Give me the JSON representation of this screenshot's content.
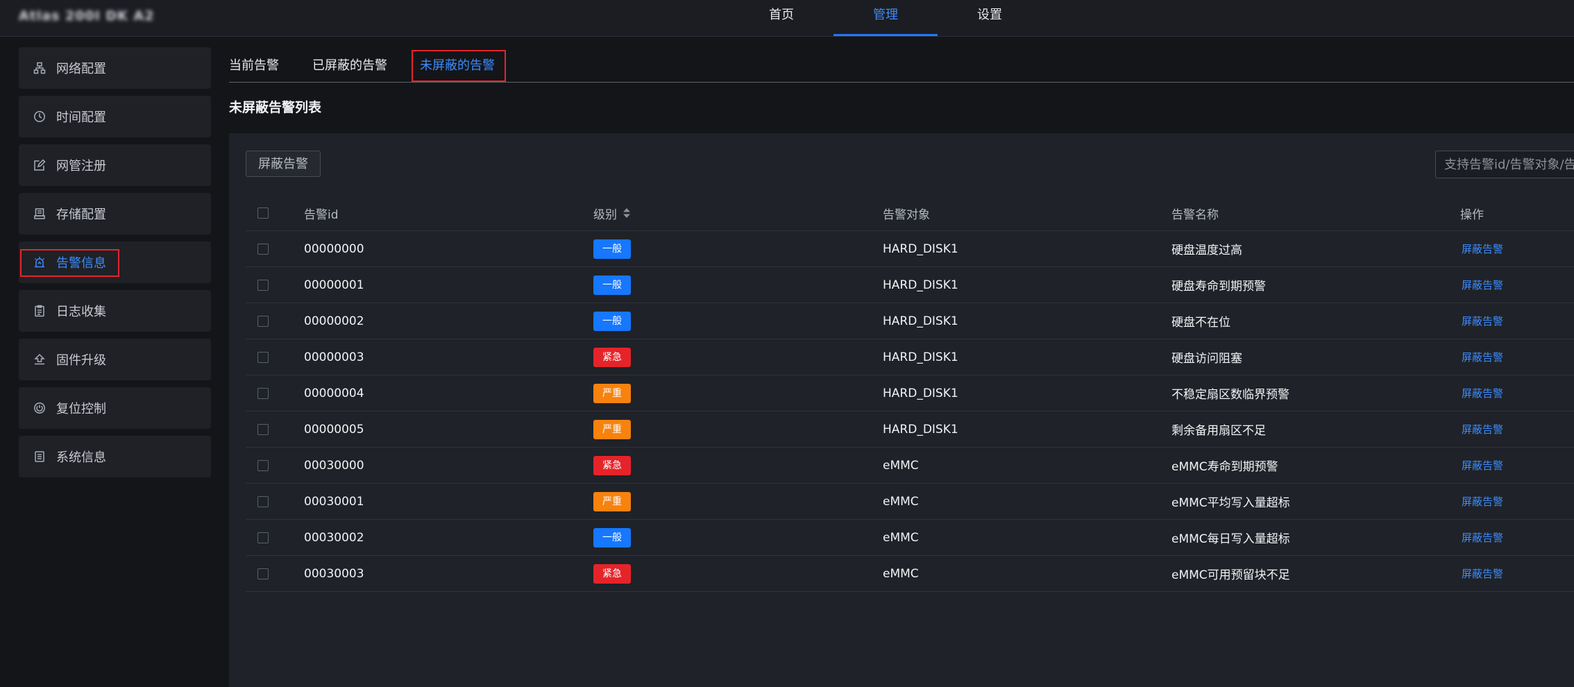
{
  "app": {
    "title": "Atlas 200I DK A2"
  },
  "topnav": {
    "items": [
      {
        "label": "首页",
        "active": false
      },
      {
        "label": "管理",
        "active": true
      },
      {
        "label": "设置",
        "active": false
      }
    ]
  },
  "sidebar": {
    "items": [
      {
        "label": "网络配置",
        "icon": "network-icon",
        "active": false
      },
      {
        "label": "时间配置",
        "icon": "clock-icon",
        "active": false
      },
      {
        "label": "网管注册",
        "icon": "edit-icon",
        "active": false
      },
      {
        "label": "存储配置",
        "icon": "storage-icon",
        "active": false
      },
      {
        "label": "告警信息",
        "icon": "alarm-icon",
        "active": true
      },
      {
        "label": "日志收集",
        "icon": "log-icon",
        "active": false
      },
      {
        "label": "固件升级",
        "icon": "upgrade-icon",
        "active": false
      },
      {
        "label": "复位控制",
        "icon": "power-icon",
        "active": false
      },
      {
        "label": "系统信息",
        "icon": "info-icon",
        "active": false
      }
    ]
  },
  "subtabs": [
    {
      "label": "当前告警",
      "active": false
    },
    {
      "label": "已屏蔽的告警",
      "active": false
    },
    {
      "label": "未屏蔽的告警",
      "active": true
    }
  ],
  "section": {
    "title": "未屏蔽告警列表"
  },
  "toolbar": {
    "mask_label": "屏蔽告警",
    "search_placeholder": "支持告警id/告警对象/告警名称搜索"
  },
  "table": {
    "columns": [
      "告警id",
      "级别",
      "告警对象",
      "告警名称",
      "操作"
    ],
    "level_colors": {
      "一般": "#1677ff",
      "紧急": "#e5242a",
      "严重": "#f7820e"
    },
    "rows": [
      {
        "id": "00000000",
        "level": "一般",
        "object": "HARD_DISK1",
        "name": "硬盘温度过高",
        "action": "屏蔽告警"
      },
      {
        "id": "00000001",
        "level": "一般",
        "object": "HARD_DISK1",
        "name": "硬盘寿命到期预警",
        "action": "屏蔽告警"
      },
      {
        "id": "00000002",
        "level": "一般",
        "object": "HARD_DISK1",
        "name": "硬盘不在位",
        "action": "屏蔽告警"
      },
      {
        "id": "00000003",
        "level": "紧急",
        "object": "HARD_DISK1",
        "name": "硬盘访问阻塞",
        "action": "屏蔽告警"
      },
      {
        "id": "00000004",
        "level": "严重",
        "object": "HARD_DISK1",
        "name": "不稳定扇区数临界预警",
        "action": "屏蔽告警"
      },
      {
        "id": "00000005",
        "level": "严重",
        "object": "HARD_DISK1",
        "name": "剩余备用扇区不足",
        "action": "屏蔽告警"
      },
      {
        "id": "00030000",
        "level": "紧急",
        "object": "eMMC",
        "name": "eMMC寿命到期预警",
        "action": "屏蔽告警"
      },
      {
        "id": "00030001",
        "level": "严重",
        "object": "eMMC",
        "name": "eMMC平均写入量超标",
        "action": "屏蔽告警"
      },
      {
        "id": "00030002",
        "level": "一般",
        "object": "eMMC",
        "name": "eMMC每日写入量超标",
        "action": "屏蔽告警"
      },
      {
        "id": "00030003",
        "level": "紧急",
        "object": "eMMC",
        "name": "eMMC可用预留块不足",
        "action": "屏蔽告警"
      }
    ]
  }
}
